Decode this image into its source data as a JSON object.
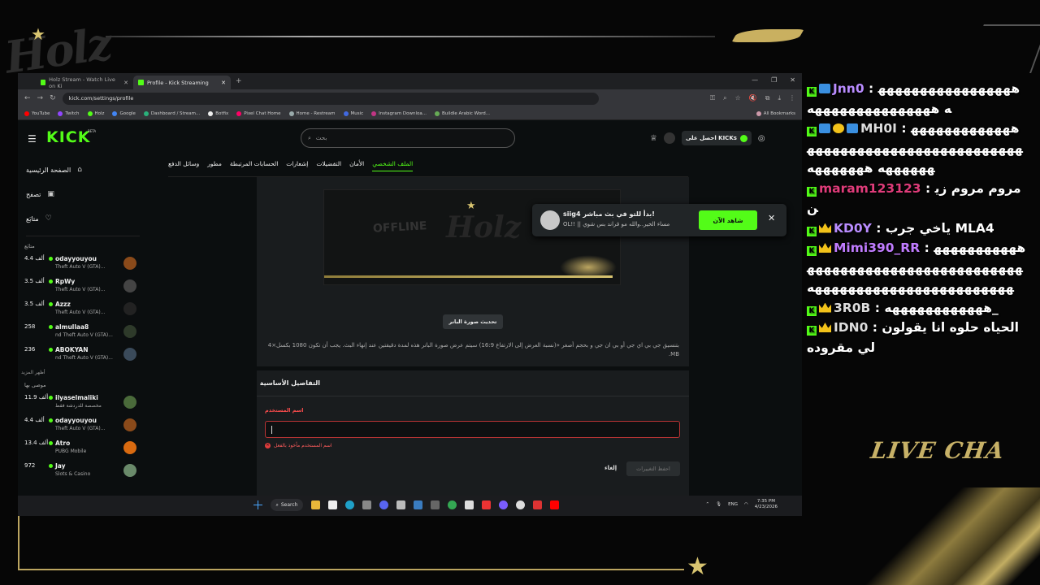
{
  "browser": {
    "tabs": [
      {
        "title": "Holz Stream - Watch Live on Ki",
        "active": false
      },
      {
        "title": "Profile - Kick Streaming",
        "active": true
      }
    ],
    "url": "kick.com/settings/profile",
    "bookmarks": [
      "YouTube",
      "Twitch",
      "Holz",
      "Google",
      "Dashboard / Stream...",
      "Botfix",
      "Pixel Chat Home",
      "Home - Restream",
      "Music",
      "Instagram Downloa...",
      "Buildle Arabic Word..."
    ],
    "all_bookmarks": "All Bookmarks"
  },
  "kick": {
    "logo": "KICK",
    "beta": "BETA",
    "search_placeholder": "بحث",
    "kicks_button": "احصل على KICKs",
    "sidebar": {
      "nav": [
        {
          "label": "الصفحة الرئيسية",
          "icon": "home-icon"
        },
        {
          "label": "تصفح",
          "icon": "browse-icon"
        },
        {
          "label": "متابَع",
          "icon": "heart-icon"
        }
      ],
      "following_heading": "متابَع",
      "following": [
        {
          "name": "odayyouyou",
          "game": "Theft Auto V (GTA)...",
          "viewers": "4.4 ألف"
        },
        {
          "name": "RpWy",
          "game": "Theft Auto V (GTA)...",
          "viewers": "3.5 ألف"
        },
        {
          "name": "Azzz",
          "game": "Theft Auto V (GTA)...",
          "viewers": "3.5 ألف"
        },
        {
          "name": "almullaa8",
          "game": "nd Theft Auto V (GTA)...",
          "viewers": "258"
        },
        {
          "name": "ABOKYAN",
          "game": "nd Theft Auto V (GTA)...",
          "viewers": "236"
        }
      ],
      "show_more": "أظهر المزيد",
      "recommended_heading": "موصى بها",
      "recommended": [
        {
          "name": "ilyaselmaliki",
          "game": "مخصصة للدردشة فقط",
          "viewers": "11.9 ألف"
        },
        {
          "name": "odayyouyou",
          "game": "Theft Auto V (GTA)...",
          "viewers": "4.4 ألف"
        },
        {
          "name": "Atro",
          "game": "PUBG Mobile",
          "viewers": "13.4 ألف"
        },
        {
          "name": "Jay",
          "game": "Slots & Casino",
          "viewers": "972"
        }
      ]
    },
    "settings_tabs": [
      "وسائل الدفع",
      "مطور",
      "الحسابات المرتبطة",
      "إشعارات",
      "التفضيلات",
      "الأمان",
      "الملف الشخصي"
    ],
    "banner": {
      "offline_text": "OFFLINE",
      "holz_text": "Holz",
      "update_button": "تحديث صورة البانر",
      "help_text": "بتنسيق جي بي اي جي أو بي ان جي و بحجم أصغر «(نسبة العرض إلى الارتفاع 16:9) سيتم عرض صورة البانر هذه لمدة دقيقتين عند إنهاء البث. يجب أن تكون 1080 بكسل×4 MB."
    },
    "basic_details": {
      "title": "التفاصيل الأساسية",
      "username_label": "اسم المستخدم",
      "error": "اسم المستخدم مأخوذ بالفعل",
      "cancel": "إلغاء",
      "save": "احفظ التغييرات"
    },
    "toast": {
      "title": "siig4 بدأ للتو في بث مباشر!",
      "subtitle": "OL!! || مساء الخير..والله مو قراند بس شوي",
      "watch_button": "شاهد الآن"
    }
  },
  "taskbar": {
    "search": "Search",
    "lang": "ENG",
    "time": "7:35 PM",
    "date": "4/23/2026"
  },
  "chat": {
    "messages": [
      {
        "user": "Jnn0",
        "text": "هههههههههههههههههه هههههههههههههههه",
        "color": "#b98cff"
      },
      {
        "user": "MH0I",
        "text": "هههههههههههههههههههههههههههههههههههههههههههههه هههههههه",
        "color": "#dddddd"
      },
      {
        "user": "maram123123",
        "text": "مروم مروم زين",
        "color": "#e03c7a"
      },
      {
        "user": "KD0Y",
        "text": "ياخي جرب MLA4",
        "color": "#b98cff"
      },
      {
        "user": "Mimi390_RR",
        "text": "هههههههههههههههههههههههههههههههههههههههههههههههههههههههههههههه",
        "color": "#c07cff"
      },
      {
        "user": "3R0B",
        "text": "ههههههههههههه_",
        "color": "#dddddd"
      },
      {
        "user": "IDN0",
        "text": "الحياه حلوه انا يقولون لي مقروده",
        "color": "#dddddd"
      }
    ],
    "live_chat_label": "LIVE CHA"
  },
  "colors": {
    "kick_green": "#53fc18",
    "gold": "#d8c470",
    "error_red": "#ff4d4d"
  }
}
